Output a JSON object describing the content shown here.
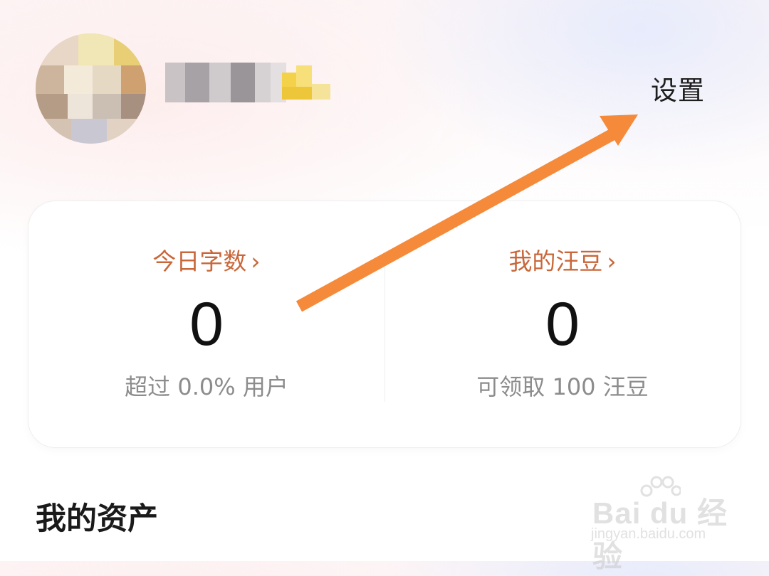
{
  "header": {
    "settings_label": "设置"
  },
  "stats": {
    "left": {
      "title": "今日字数",
      "value": "0",
      "desc": "超过 0.0% 用户"
    },
    "right": {
      "title": "我的汪豆",
      "value": "0",
      "desc": "可领取 100 汪豆"
    },
    "chevron": "›"
  },
  "sections": {
    "assets_title": "我的资产"
  },
  "watermark": {
    "brand": "Bai du 经验",
    "url": "jingyan.baidu.com"
  },
  "colors": {
    "accent": "#c9673a",
    "arrow": "#f58a3a"
  },
  "icons": {
    "avatar": "avatar-pixelated",
    "badge": "crown-badge-icon",
    "arrow": "annotation-arrow"
  }
}
